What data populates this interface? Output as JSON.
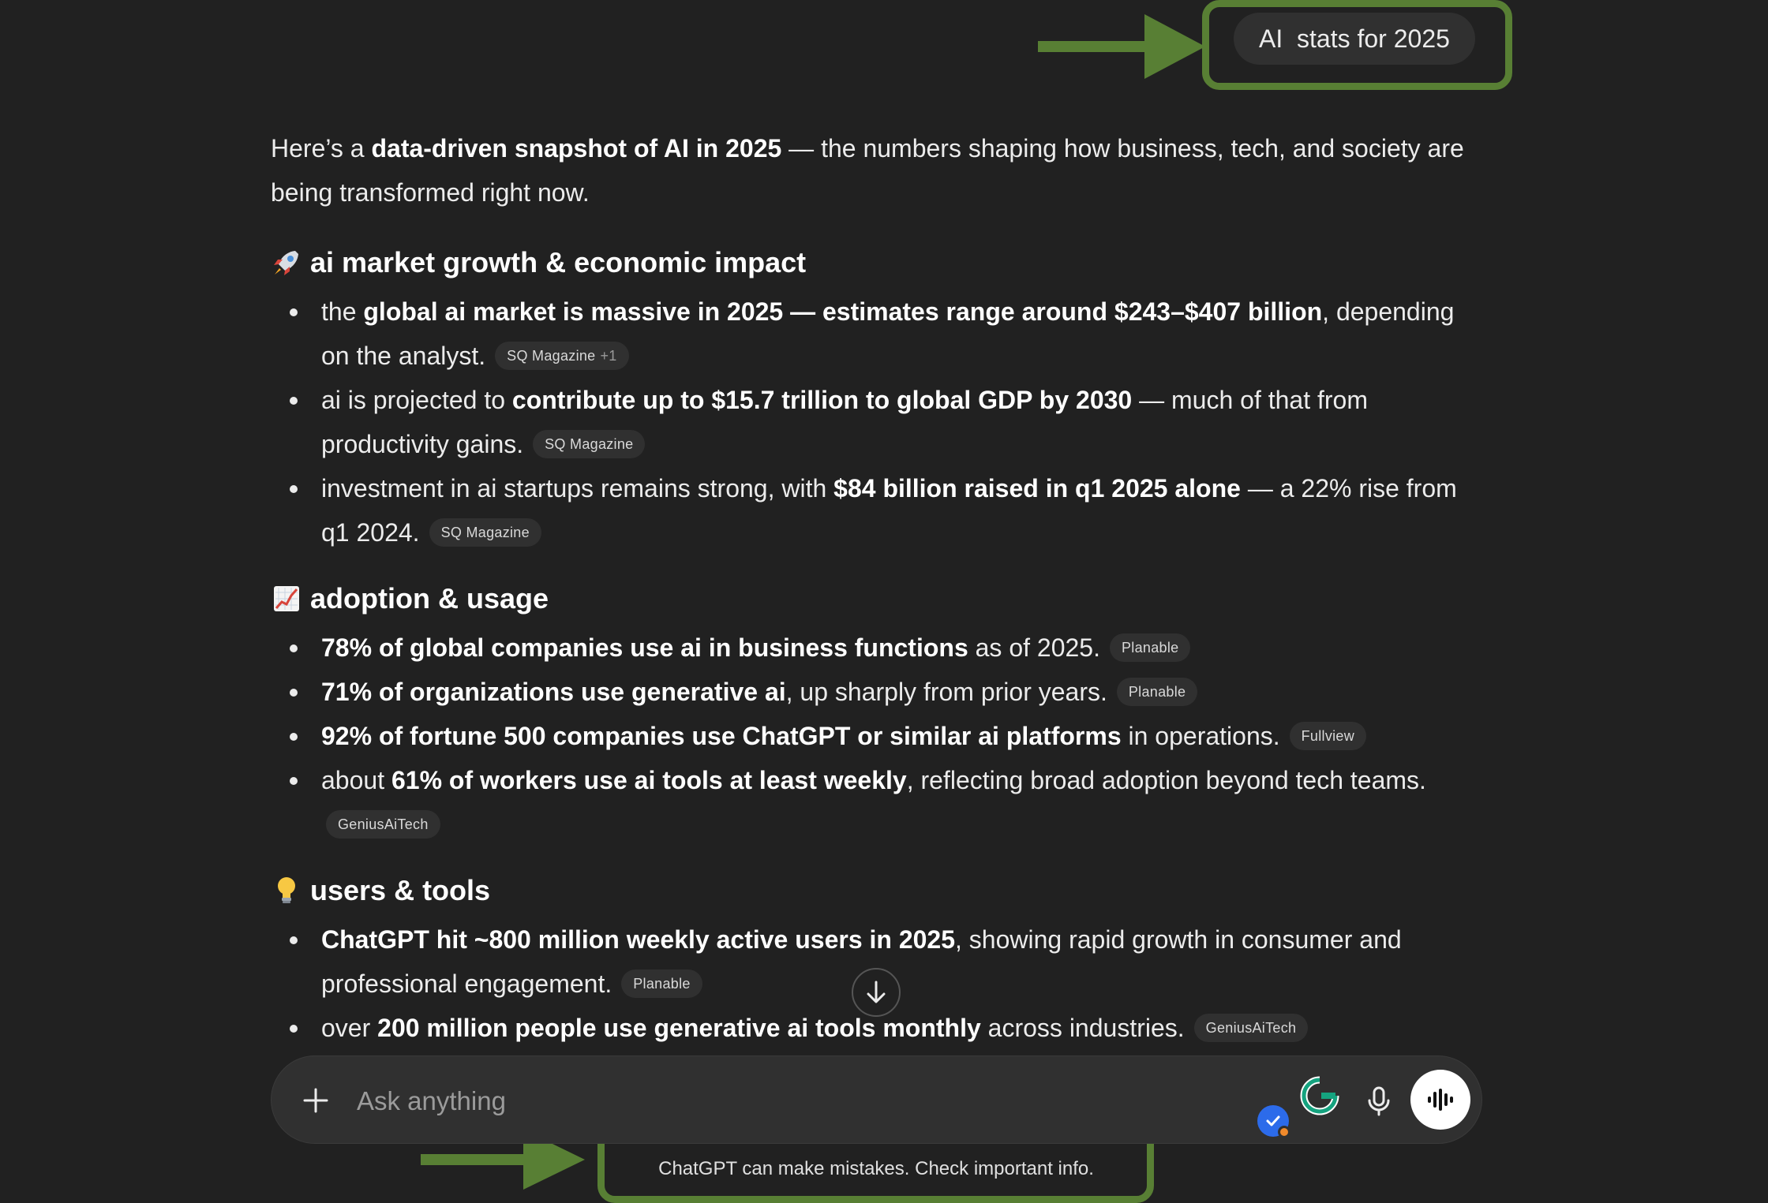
{
  "user_message": "AI  stats for 2025",
  "response": {
    "intro": {
      "pre": "Here’s a ",
      "bold": "data-driven snapshot of AI in 2025",
      "post": " — the numbers shaping how business, tech, and society are being transformed right now."
    },
    "sections": [
      {
        "icon": "rocket-icon",
        "heading": "ai market growth & economic impact",
        "items": [
          {
            "pre": "the ",
            "bold": "global ai market is massive in 2025 — estimates range around $243–$407 billion",
            "post": ", depending on the analyst.",
            "source": "SQ Magazine",
            "source_more": "+1"
          },
          {
            "pre": "ai is projected to ",
            "bold": "contribute up to $15.7 trillion to global GDP by 2030",
            "post": " — much of that from productivity gains.",
            "source": "SQ Magazine"
          },
          {
            "pre": "investment in ai startups remains strong, with ",
            "bold": "$84 billion raised in q1 2025 alone",
            "post": " — a 22% rise from q1 2024.",
            "source": "SQ Magazine"
          }
        ]
      },
      {
        "icon": "chart-increasing-icon",
        "heading": "adoption & usage",
        "items": [
          {
            "pre": "",
            "bold": "78% of global companies use ai in business functions",
            "post": " as of 2025.",
            "source": "Planable"
          },
          {
            "pre": "",
            "bold": "71% of organizations use generative ai",
            "post": ", up sharply from prior years.",
            "source": "Planable"
          },
          {
            "pre": "",
            "bold": "92% of fortune 500 companies use ChatGPT or similar ai platforms",
            "post": " in operations.",
            "source": "Fullview"
          },
          {
            "pre": "about ",
            "bold": "61% of workers use ai tools at least weekly",
            "post": ", reflecting broad adoption beyond tech teams.",
            "source": "GeniusAiTech"
          }
        ]
      },
      {
        "icon": "light-bulb-icon",
        "heading": "users & tools",
        "items": [
          {
            "pre": "",
            "bold": "ChatGPT hit ~800 million weekly active users in 2025",
            "post": ", showing rapid growth in consumer and professional engagement.",
            "source": "Planable"
          },
          {
            "pre": "over ",
            "bold": "200 million people use generative ai tools monthly",
            "post": " across industries.",
            "source": "GeniusAiTech"
          }
        ]
      }
    ]
  },
  "composer": {
    "placeholder": "Ask anything"
  },
  "disclaimer": "ChatGPT can make mistakes. Check important info.",
  "colors": {
    "background": "#212121",
    "highlight": "#587f34",
    "bubble": "#303030"
  }
}
